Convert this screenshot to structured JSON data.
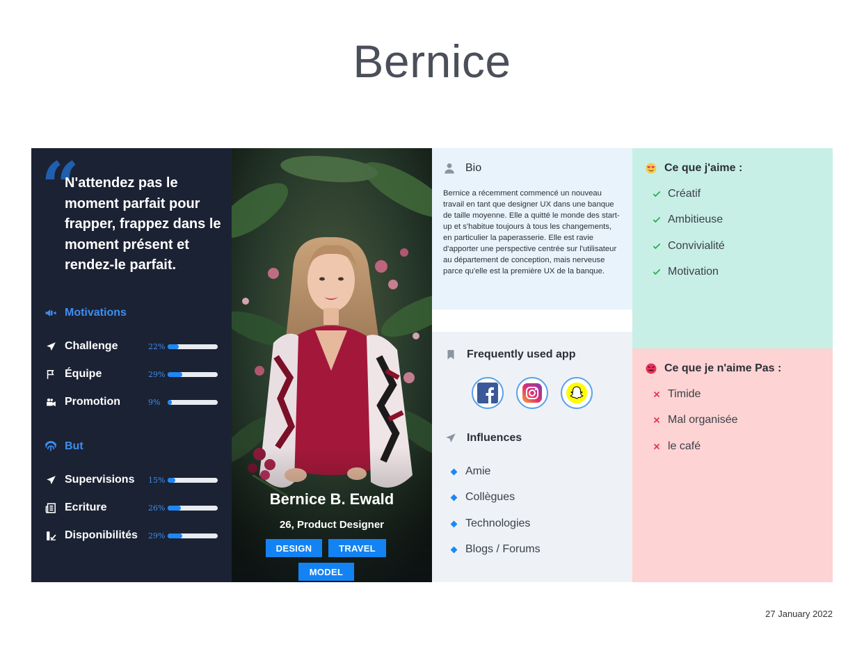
{
  "title": "Bernice",
  "quote": "N'attendez pas le moment parfait pour frapper, frappez dans le moment présent et rendez-le parfait.",
  "motivations": {
    "heading": "Motivations",
    "items": [
      {
        "label": "Challenge",
        "pct_text": "22%",
        "value": 0.22,
        "icon": "navigation-arrow-icon"
      },
      {
        "label": "Équipe",
        "pct_text": "29%",
        "value": 0.29,
        "icon": "flag-icon"
      },
      {
        "label": "Promotion",
        "pct_text": "9%",
        "value": 0.09,
        "icon": "video-camera-icon"
      }
    ]
  },
  "goals": {
    "heading": "But",
    "items": [
      {
        "label": "Supervisions",
        "pct_text": "15%",
        "value": 0.15,
        "icon": "navigation-arrow-icon"
      },
      {
        "label": "Ecriture",
        "pct_text": "26%",
        "value": 0.26,
        "icon": "newspaper-icon"
      },
      {
        "label": "Disponibilités",
        "pct_text": "29%",
        "value": 0.29,
        "icon": "user-check-icon"
      }
    ]
  },
  "profile": {
    "name": "Bernice B. Ewald",
    "subtitle": "26, Product Designer",
    "tags": [
      "DESIGN",
      "TRAVEL",
      "MODEL"
    ]
  },
  "bio": {
    "heading": "Bio",
    "text": "Bernice a récemment commencé un nouveau travail en tant que designer UX dans une banque de taille moyenne. Elle a quitté le monde des start-up et s'habitue toujours à tous les changements, en particulier la paperasserie. Elle est ravie d'apporter une perspective centrée sur l'utilisateur au département de conception, mais nerveuse parce qu'elle est la première UX de la banque."
  },
  "apps": {
    "heading": "Frequently used app",
    "items": [
      "facebook-icon",
      "instagram-icon",
      "snapchat-icon"
    ]
  },
  "influences": {
    "heading": "Influences",
    "items": [
      "Amie",
      "Collègues",
      "Technologies",
      "Blogs / Forums"
    ]
  },
  "likes": {
    "heading": "Ce que j'aime :",
    "items": [
      "Créatif",
      "Ambitieuse",
      "Convivialité",
      "Motivation"
    ]
  },
  "dislikes": {
    "heading": "Ce que je n'aime Pas :",
    "items": [
      "Timide",
      "Mal organisée",
      "le café"
    ]
  },
  "date": "27 January 2022",
  "colors": {
    "dark_panel": "#1b2233",
    "accent_blue": "#1d87f5",
    "bio_bg": "#e9f3fb",
    "likes_bg": "#c8efe6",
    "dislikes_bg": "#fdd3d3",
    "check_green": "#22b14c",
    "cross_red": "#e8325a"
  }
}
